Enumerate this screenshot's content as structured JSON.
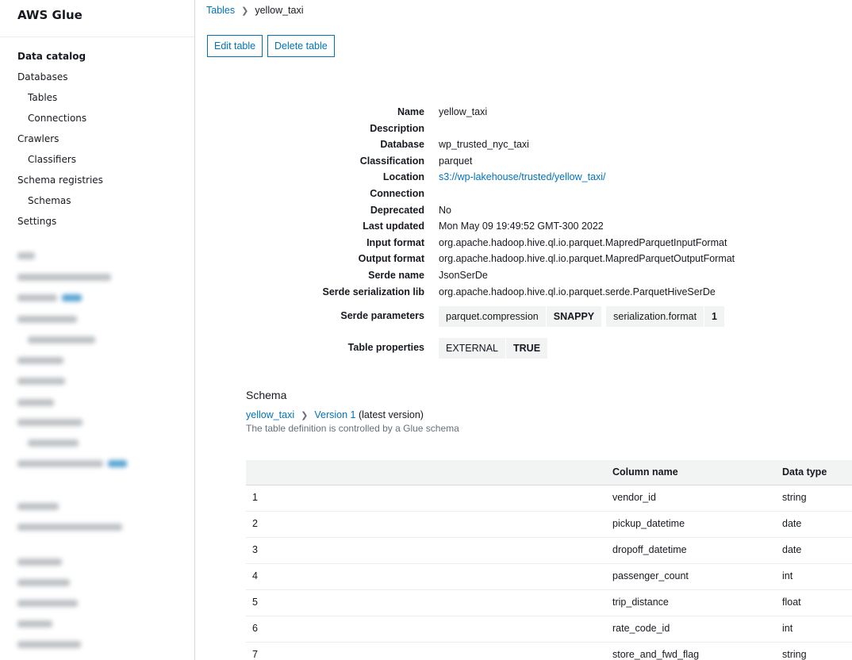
{
  "app": {
    "title": "AWS Glue"
  },
  "sidebar": {
    "items": [
      {
        "label": "Data catalog",
        "level": "head"
      },
      {
        "label": "Databases",
        "level": "top"
      },
      {
        "label": "Tables",
        "level": "sub"
      },
      {
        "label": "Connections",
        "level": "sub"
      },
      {
        "label": "Crawlers",
        "level": "top"
      },
      {
        "label": "Classifiers",
        "level": "sub"
      },
      {
        "label": "Schema registries",
        "level": "top"
      },
      {
        "label": "Schemas",
        "level": "sub"
      },
      {
        "label": "Settings",
        "level": "top"
      }
    ]
  },
  "breadcrumb": {
    "parent": "Tables",
    "current": "yellow_taxi"
  },
  "actions": {
    "edit": "Edit table",
    "delete": "Delete table"
  },
  "details": {
    "name": {
      "label": "Name",
      "value": "yellow_taxi"
    },
    "description": {
      "label": "Description",
      "value": ""
    },
    "database": {
      "label": "Database",
      "value": "wp_trusted_nyc_taxi"
    },
    "classification": {
      "label": "Classification",
      "value": "parquet"
    },
    "location": {
      "label": "Location",
      "value": "s3://wp-lakehouse/trusted/yellow_taxi/"
    },
    "connection": {
      "label": "Connection",
      "value": ""
    },
    "deprecated": {
      "label": "Deprecated",
      "value": "No"
    },
    "last_updated": {
      "label": "Last updated",
      "value": "Mon May 09 19:49:52 GMT-300 2022"
    },
    "input_format": {
      "label": "Input format",
      "value": "org.apache.hadoop.hive.ql.io.parquet.MapredParquetInputFormat"
    },
    "output_format": {
      "label": "Output format",
      "value": "org.apache.hadoop.hive.ql.io.parquet.MapredParquetOutputFormat"
    },
    "serde_name": {
      "label": "Serde name",
      "value": "JsonSerDe"
    },
    "serde_lib": {
      "label": "Serde serialization lib",
      "value": "org.apache.hadoop.hive.ql.io.parquet.serde.ParquetHiveSerDe"
    },
    "serde_params": {
      "label": "Serde parameters",
      "tags": [
        {
          "key": "parquet.compression",
          "value": "SNAPPY"
        },
        {
          "key": "serialization.format",
          "value": "1"
        }
      ]
    },
    "table_props": {
      "label": "Table properties",
      "tags": [
        {
          "key": "EXTERNAL",
          "value": "TRUE"
        }
      ]
    }
  },
  "schema": {
    "title": "Schema",
    "table_link": "yellow_taxi",
    "version_link": "Version 1",
    "version_suffix": "(latest version)",
    "note": "The table definition is controlled by a Glue schema",
    "columns": {
      "index": "",
      "name": "Column name",
      "type": "Data type"
    },
    "rows": [
      {
        "index": "1",
        "name": "vendor_id",
        "type": "string"
      },
      {
        "index": "2",
        "name": "pickup_datetime",
        "type": "date"
      },
      {
        "index": "3",
        "name": "dropoff_datetime",
        "type": "date"
      },
      {
        "index": "4",
        "name": "passenger_count",
        "type": "int"
      },
      {
        "index": "5",
        "name": "trip_distance",
        "type": "float"
      },
      {
        "index": "6",
        "name": "rate_code_id",
        "type": "int"
      },
      {
        "index": "7",
        "name": "store_and_fwd_flag",
        "type": "string"
      }
    ]
  }
}
